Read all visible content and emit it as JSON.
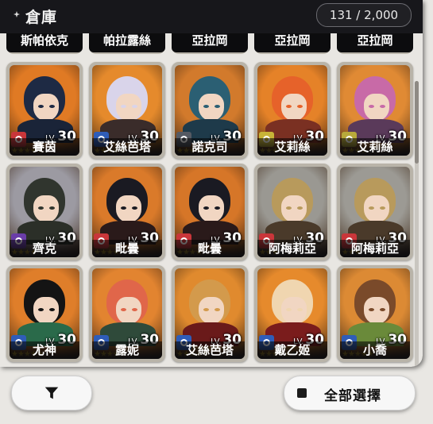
{
  "header": {
    "title": "倉庫",
    "capacity": "131 / 2,000"
  },
  "top_row": [
    "斯帕依克",
    "帕拉露絲",
    "亞拉岡",
    "亞拉岡",
    "亞拉岡"
  ],
  "characters": [
    {
      "name": "賽茵",
      "level": "30",
      "stars": 5,
      "class": "warrior",
      "classColor": "#c9363a",
      "bg": "#e07a24",
      "hair": "#1e2a44",
      "cloth": "#1a2438"
    },
    {
      "name": "艾絲芭塔",
      "level": "30",
      "stars": 5,
      "class": "guardian",
      "classColor": "#2f5db8",
      "bg": "#e58a2c",
      "hair": "#d9d4ea",
      "cloth": "#3a2c2a"
    },
    {
      "name": "諾克司",
      "level": "30",
      "stars": 5,
      "class": "defender",
      "classColor": "#555a63",
      "bg": "#d27a2c",
      "hair": "#2b5f73",
      "cloth": "#1e3a4a"
    },
    {
      "name": "艾莉絲",
      "level": "30",
      "stars": 5,
      "class": "healer",
      "classColor": "#c8b437",
      "bg": "#e58228",
      "hair": "#e6622a",
      "cloth": "#7a3022"
    },
    {
      "name": "艾莉絲",
      "level": "30",
      "stars": 4,
      "class": "healer",
      "classColor": "#b8a93a",
      "bg": "#e08a34",
      "hair": "#c86aa7",
      "cloth": "#5a3a5a"
    },
    {
      "name": "齊克",
      "level": "30",
      "stars": 4,
      "class": "mage",
      "classColor": "#6a3da8",
      "bg": "#9c9aa2",
      "hair": "#30352e",
      "cloth": "#2b2f28"
    },
    {
      "name": "毗曇",
      "level": "30",
      "stars": 4,
      "class": "warrior",
      "classColor": "#c9363a",
      "bg": "#da7a2a",
      "hair": "#1a1a22",
      "cloth": "#2a1a1a"
    },
    {
      "name": "毗曇",
      "level": "30",
      "stars": 4,
      "class": "warrior",
      "classColor": "#c9363a",
      "bg": "#d67628",
      "hair": "#1a1a22",
      "cloth": "#2a1a1a"
    },
    {
      "name": "阿梅莉亞",
      "level": "30",
      "stars": 3,
      "class": "warrior",
      "classColor": "#c9363a",
      "bg": "#9a9892",
      "hair": "#b89a5c",
      "cloth": "#4a3a2a"
    },
    {
      "name": "阿梅莉亞",
      "level": "30",
      "stars": 3,
      "class": "warrior",
      "classColor": "#c9363a",
      "bg": "#9c9a94",
      "hair": "#b89a5c",
      "cloth": "#4a3a2a"
    },
    {
      "name": "尤神",
      "level": "30",
      "stars": 5,
      "class": "guardian",
      "classColor": "#2f5db8",
      "bg": "#df7e2a",
      "hair": "#141414",
      "cloth": "#2a6a4a"
    },
    {
      "name": "露妮",
      "level": "30",
      "stars": 5,
      "class": "guardian",
      "classColor": "#2f5db8",
      "bg": "#e28430",
      "hair": "#e0664a",
      "cloth": "#2f4a3a"
    },
    {
      "name": "艾絲芭塔",
      "level": "30",
      "stars": 5,
      "class": "guardian",
      "classColor": "#2f5db8",
      "bg": "#e08a2e",
      "hair": "#d39a4c",
      "cloth": "#6a1a1a"
    },
    {
      "name": "戴乙姬",
      "level": "30",
      "stars": 5,
      "class": "guardian",
      "classColor": "#2f5db8",
      "bg": "#e68a2c",
      "hair": "#f0d6b0",
      "cloth": "#7a1c1c"
    },
    {
      "name": "小喬",
      "level": "30",
      "stars": 5,
      "class": "guardian",
      "classColor": "#2f5db8",
      "bg": "#dc8a34",
      "hair": "#7a4a2a",
      "cloth": "#6a8a3a"
    }
  ],
  "lv_prefix": "LV.",
  "buttons": {
    "filter_icon": "filter-icon",
    "select_all": "全部選擇"
  }
}
